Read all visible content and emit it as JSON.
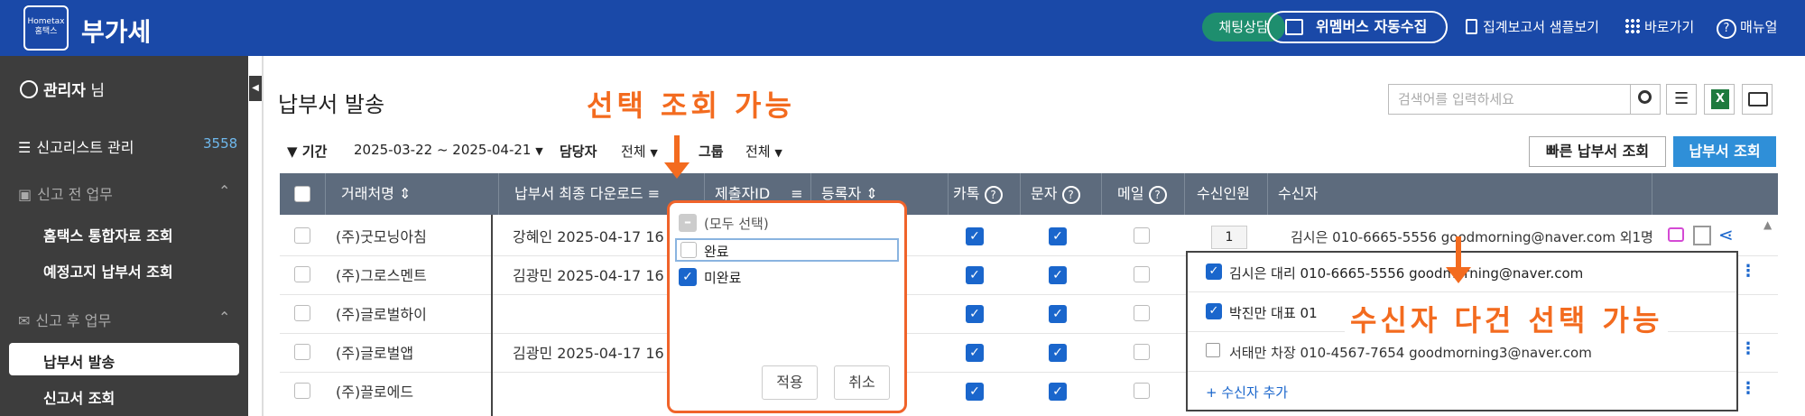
{
  "app": {
    "logo_top": "Hometax",
    "logo_bottom": "홈택스",
    "title": "부가세"
  },
  "topnav": {
    "chat": "채팅상담",
    "wemembers": "위멤버스 자동수집",
    "report": "집계보고서 샘플보기",
    "shortcut": "바로가기",
    "manual": "매뉴얼"
  },
  "sidebar": {
    "user": "관리자",
    "user_suffix": "님",
    "report_list": "신고리스트 관리",
    "report_count": "3558",
    "pre_section": "신고 전 업무",
    "pre_items": [
      "홈택스 통합자료 조회",
      "예정고지 납부서 조회"
    ],
    "post_section": "신고 후 업무",
    "post_items": [
      "납부서 발송",
      "신고서 조회"
    ]
  },
  "page": {
    "title": "납부서 발송",
    "search_placeholder": "검색어를 입력하세요"
  },
  "filters": {
    "period_label": "기간",
    "period_value": "2025-03-22 ~ 2025-04-21",
    "manager_label": "담당자",
    "manager_value": "전체",
    "group_label": "그룹",
    "group_value": "전체",
    "quick_button": "빠른 납부서 조회",
    "view_button": "납부서 조회"
  },
  "table": {
    "columns": [
      "거래처명",
      "납부서 최종 다운로드",
      "제출자ID",
      "등록자",
      "카톡",
      "문자",
      "메일",
      "수신인원",
      "수신자"
    ],
    "rows": [
      {
        "name": "(주)굿모닝아침",
        "download": "강혜인 2025-04-17 16",
        "kakao": true,
        "sms": true,
        "mail": false,
        "count": "1",
        "recipient": "김시은 010-6665-5556 goodmorning@naver.com 외1명"
      },
      {
        "name": "(주)그로스멘트",
        "download": "김광민 2025-04-17 16",
        "kakao": true,
        "sms": true,
        "mail": false
      },
      {
        "name": "(주)글로벌하이",
        "download": "",
        "kakao": true,
        "sms": true,
        "mail": false
      },
      {
        "name": "(주)글로벌앱",
        "download": "김광민 2025-04-17 16",
        "kakao": true,
        "sms": true,
        "mail": false
      },
      {
        "name": "(주)끌로에드",
        "download": "",
        "kakao": true,
        "sms": true,
        "mail": false
      }
    ]
  },
  "filter_popup": {
    "options": [
      "(모두 선택)",
      "완료",
      "미완료"
    ],
    "apply": "적용",
    "cancel": "취소"
  },
  "recipient_popup": {
    "items": [
      {
        "text": "김시은 대리 010-6665-5556 goodmorning@naver.com",
        "checked": true
      },
      {
        "text": "박진만 대표 01",
        "checked": true
      },
      {
        "text": "서태만 차장 010-4567-7654 goodmorning3@naver.com",
        "checked": false
      }
    ],
    "add": "+ 수신자 추가"
  },
  "annotations": {
    "select_query": "선택 조회 가능",
    "multi_select": "수신자 다건 선택 가능"
  },
  "colors": {
    "topbar": "#1a49a8",
    "sidebar": "#3d3d3d",
    "header": "#5d6b7d",
    "accent": "#2f8fd8",
    "annotation": "#f36b1f",
    "checkbox": "#1a66cc"
  }
}
